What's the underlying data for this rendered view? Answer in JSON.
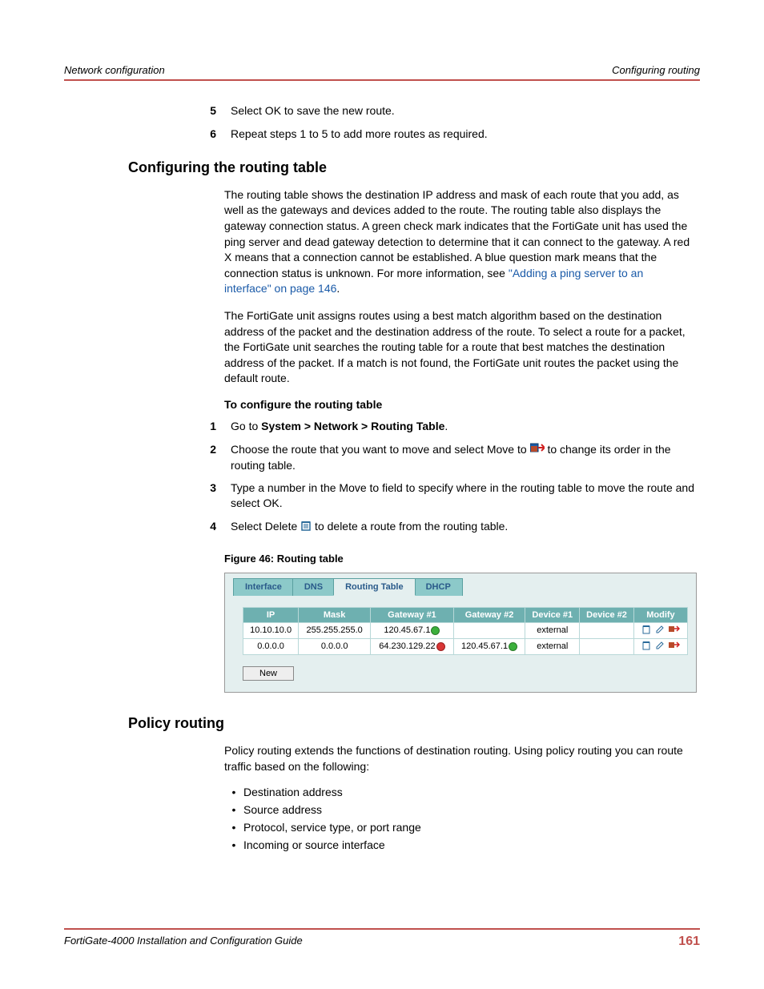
{
  "header": {
    "left": "Network configuration",
    "right": "Configuring routing"
  },
  "steps_top": [
    {
      "n": "5",
      "text": "Select OK to save the new route."
    },
    {
      "n": "6",
      "text": "Repeat steps 1 to 5 to add more routes as required."
    }
  ],
  "section1": {
    "title": "Configuring the routing table",
    "para1_a": "The routing table shows the destination IP address and mask of each route that you add, as well as the gateways and devices added to the route. The routing table also displays the gateway connection status. A green check mark indicates that the FortiGate unit has used the ping server and dead gateway detection to determine that it can connect to the gateway. A red X means that a connection cannot be established. A blue question mark means that the connection status is unknown. For more information, see ",
    "para1_link": "\"Adding a ping server to an interface\" on page 146",
    "para1_b": ".",
    "para2": "The FortiGate unit assigns routes using a best match algorithm based on the destination address of the packet and the destination address of the route. To select a route for a packet, the FortiGate unit searches the routing table for a route that best matches the destination address of the packet. If a match is not found, the FortiGate unit routes the packet using the default route.",
    "subheading": "To configure the routing table"
  },
  "steps_config": {
    "s1_a": "Go to ",
    "s1_bold": "System > Network > Routing Table",
    "s1_b": ".",
    "s2_a": "Choose the route that you want to move and select Move to ",
    "s2_b": " to change its order in the routing table.",
    "s3": "Type a number in the Move to field to specify where in the routing table to move the route and select OK.",
    "s4_a": "Select Delete ",
    "s4_b": " to delete a route from the routing table."
  },
  "figure": {
    "caption": "Figure 46: Routing table",
    "tabs": [
      "Interface",
      "DNS",
      "Routing Table",
      "DHCP"
    ],
    "active_tab": 2,
    "headers": [
      "IP",
      "Mask",
      "Gateway #1",
      "Gateway #2",
      "Device #1",
      "Device #2",
      "Modify"
    ],
    "rows": [
      {
        "ip": "10.10.10.0",
        "mask": "255.255.255.0",
        "gw1": "120.45.67.1",
        "gw1s": "green",
        "gw2": "",
        "gw2s": "",
        "dev1": "external",
        "dev2": ""
      },
      {
        "ip": "0.0.0.0",
        "mask": "0.0.0.0",
        "gw1": "64.230.129.22",
        "gw1s": "redx",
        "gw2": "120.45.67.1",
        "gw2s": "green",
        "dev1": "external",
        "dev2": ""
      }
    ],
    "new_btn": "New"
  },
  "section2": {
    "title": "Policy routing",
    "para": "Policy routing extends the functions of destination routing. Using policy routing you can route traffic based on the following:",
    "bullets": [
      "Destination address",
      "Source address",
      "Protocol, service type, or port range",
      "Incoming or source interface"
    ]
  },
  "footer": {
    "left": "FortiGate-4000 Installation and Configuration Guide",
    "right": "161"
  }
}
